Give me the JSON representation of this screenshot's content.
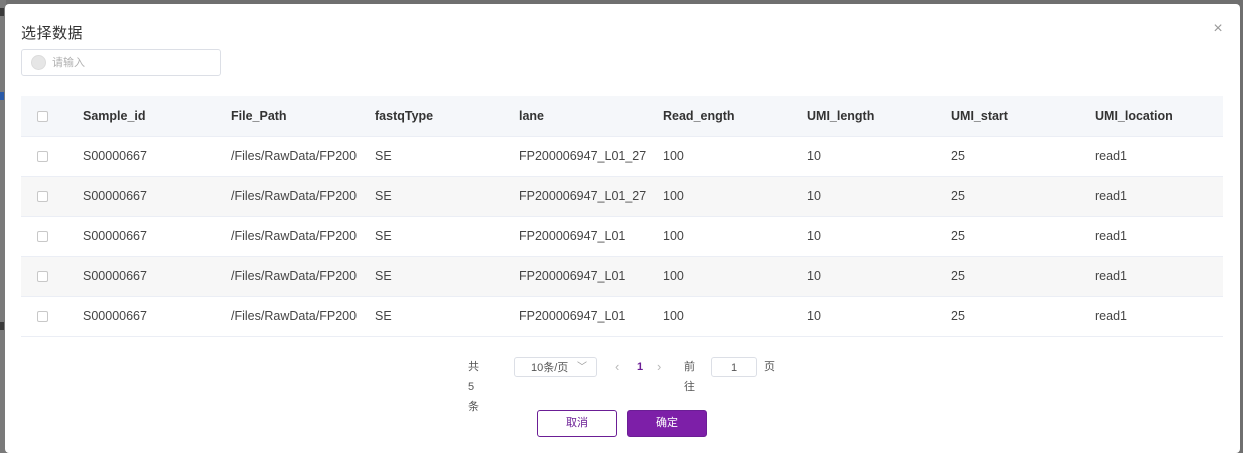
{
  "dialog": {
    "title": "选择数据",
    "close_icon": "×"
  },
  "search": {
    "placeholder": "请输入",
    "value": ""
  },
  "table": {
    "columns": [
      "Sample_id",
      "File_Path",
      "fastqType",
      "lane",
      "Read_ength",
      "UMI_length",
      "UMI_start",
      "UMI_location"
    ],
    "rows": [
      {
        "sample_id": "S00000667",
        "file_path": "/Files/RawData/FP2000",
        "fastq_type": "SE",
        "lane": "FP200006947_L01_27",
        "read_length": "100",
        "umi_length": "10",
        "umi_start": "25",
        "umi_location": "read1"
      },
      {
        "sample_id": "S00000667",
        "file_path": "/Files/RawData/FP2000",
        "fastq_type": "SE",
        "lane": "FP200006947_L01_27",
        "read_length": "100",
        "umi_length": "10",
        "umi_start": "25",
        "umi_location": "read1"
      },
      {
        "sample_id": "S00000667",
        "file_path": "/Files/RawData/FP2000",
        "fastq_type": "SE",
        "lane": "FP200006947_L01",
        "read_length": "100",
        "umi_length": "10",
        "umi_start": "25",
        "umi_location": "read1"
      },
      {
        "sample_id": "S00000667",
        "file_path": "/Files/RawData/FP2000",
        "fastq_type": "SE",
        "lane": "FP200006947_L01",
        "read_length": "100",
        "umi_length": "10",
        "umi_start": "25",
        "umi_location": "read1"
      },
      {
        "sample_id": "S00000667",
        "file_path": "/Files/RawData/FP2000",
        "fastq_type": "SE",
        "lane": "FP200006947_L01",
        "read_length": "100",
        "umi_length": "10",
        "umi_start": "25",
        "umi_location": "read1"
      }
    ]
  },
  "pagination": {
    "total": "共 5 条",
    "page_size": "10条/页",
    "current_page": "1",
    "goto_label": "前往",
    "goto_value": "1",
    "page_suffix": "页"
  },
  "buttons": {
    "cancel": "取消",
    "confirm": "确定"
  },
  "colors": {
    "accent": "#7d1fa8",
    "header_bg": "#f5f7fa"
  }
}
